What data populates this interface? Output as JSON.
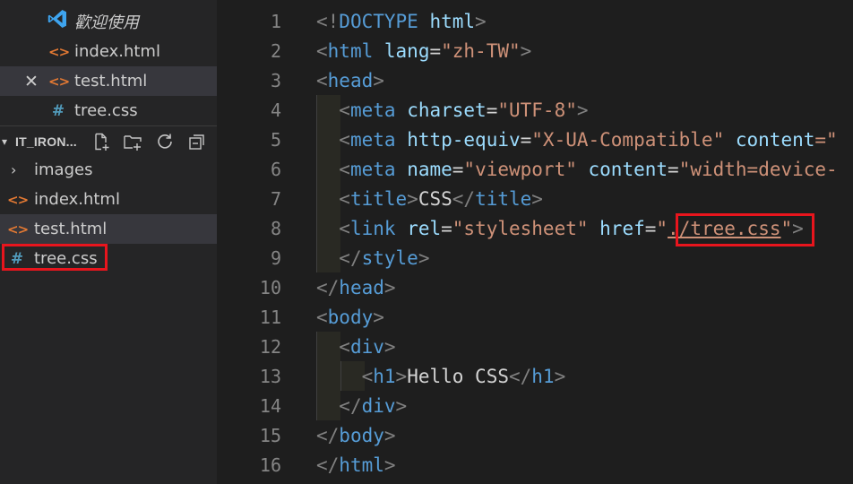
{
  "sidebar": {
    "open_editors": [
      {
        "name": "歡迎使用",
        "icon": "vscode-logo-icon",
        "close_icon": ""
      },
      {
        "name": "index.html",
        "icon": "html-file-icon",
        "close_icon": ""
      },
      {
        "name": "test.html",
        "icon": "html-file-icon",
        "close_icon": "✕",
        "active": true
      },
      {
        "name": "tree.css",
        "icon": "css-file-icon",
        "close_icon": ""
      }
    ],
    "section_title": "IT_IRON...",
    "section_chevron": "▾",
    "file_tree": [
      {
        "name": "images",
        "icon": "folder-chevron-icon",
        "glyph": "›"
      },
      {
        "name": "index.html",
        "icon": "html-file-icon",
        "glyph": "<>"
      },
      {
        "name": "test.html",
        "icon": "html-file-icon",
        "glyph": "<>",
        "active": true
      },
      {
        "name": "tree.css",
        "icon": "css-file-icon",
        "glyph": "#"
      }
    ]
  },
  "editor": {
    "line_numbers": [
      "1",
      "2",
      "3",
      "4",
      "5",
      "6",
      "7",
      "8",
      "9",
      "10",
      "11",
      "12",
      "13",
      "14",
      "15",
      "16"
    ],
    "lines": [
      [
        {
          "t": "<!",
          "c": "punc"
        },
        {
          "t": "DOCTYPE",
          "c": "tag"
        },
        {
          "t": " ",
          "c": "text"
        },
        {
          "t": "html",
          "c": "attr"
        },
        {
          "t": ">",
          "c": "punc"
        }
      ],
      [
        {
          "t": "<",
          "c": "punc"
        },
        {
          "t": "html",
          "c": "tag"
        },
        {
          "t": " ",
          "c": "text"
        },
        {
          "t": "lang",
          "c": "attr"
        },
        {
          "t": "=",
          "c": "text"
        },
        {
          "t": "\"zh-TW\"",
          "c": "str"
        },
        {
          "t": ">",
          "c": "punc"
        }
      ],
      [
        {
          "t": "<",
          "c": "punc"
        },
        {
          "t": "head",
          "c": "tag"
        },
        {
          "t": ">",
          "c": "punc"
        }
      ],
      [
        {
          "t": "  ",
          "c": "text"
        },
        {
          "t": "<",
          "c": "punc"
        },
        {
          "t": "meta",
          "c": "tag"
        },
        {
          "t": " ",
          "c": "text"
        },
        {
          "t": "charset",
          "c": "attr"
        },
        {
          "t": "=",
          "c": "text"
        },
        {
          "t": "\"UTF-8\"",
          "c": "str"
        },
        {
          "t": ">",
          "c": "punc"
        }
      ],
      [
        {
          "t": "  ",
          "c": "text"
        },
        {
          "t": "<",
          "c": "punc"
        },
        {
          "t": "meta",
          "c": "tag"
        },
        {
          "t": " ",
          "c": "text"
        },
        {
          "t": "http-equiv",
          "c": "attr"
        },
        {
          "t": "=",
          "c": "text"
        },
        {
          "t": "\"X-UA-Compatible\"",
          "c": "str"
        },
        {
          "t": " ",
          "c": "text"
        },
        {
          "t": "content",
          "c": "attr"
        },
        {
          "t": "=\"",
          "c": "str"
        }
      ],
      [
        {
          "t": "  ",
          "c": "text"
        },
        {
          "t": "<",
          "c": "punc"
        },
        {
          "t": "meta",
          "c": "tag"
        },
        {
          "t": " ",
          "c": "text"
        },
        {
          "t": "name",
          "c": "attr"
        },
        {
          "t": "=",
          "c": "text"
        },
        {
          "t": "\"viewport\"",
          "c": "str"
        },
        {
          "t": " ",
          "c": "text"
        },
        {
          "t": "content",
          "c": "attr"
        },
        {
          "t": "=",
          "c": "text"
        },
        {
          "t": "\"width=device-",
          "c": "str"
        }
      ],
      [
        {
          "t": "  ",
          "c": "text"
        },
        {
          "t": "<",
          "c": "punc"
        },
        {
          "t": "title",
          "c": "tag"
        },
        {
          "t": ">",
          "c": "punc"
        },
        {
          "t": "CSS",
          "c": "text"
        },
        {
          "t": "</",
          "c": "punc"
        },
        {
          "t": "title",
          "c": "tag"
        },
        {
          "t": ">",
          "c": "punc"
        }
      ],
      [
        {
          "t": "  ",
          "c": "text"
        },
        {
          "t": "<",
          "c": "punc"
        },
        {
          "t": "link",
          "c": "tag"
        },
        {
          "t": " ",
          "c": "text"
        },
        {
          "t": "rel",
          "c": "attr"
        },
        {
          "t": "=",
          "c": "text"
        },
        {
          "t": "\"stylesheet\"",
          "c": "str"
        },
        {
          "t": " ",
          "c": "text"
        },
        {
          "t": "href",
          "c": "attr"
        },
        {
          "t": "=",
          "c": "text"
        },
        {
          "t": "\"",
          "c": "str"
        },
        {
          "t": "./tree.css",
          "c": "str link"
        },
        {
          "t": "\"",
          "c": "str"
        },
        {
          "t": ">",
          "c": "punc"
        }
      ],
      [
        {
          "t": "  ",
          "c": "text"
        },
        {
          "t": "</",
          "c": "punc"
        },
        {
          "t": "style",
          "c": "tag"
        },
        {
          "t": ">",
          "c": "punc"
        }
      ],
      [
        {
          "t": "</",
          "c": "punc"
        },
        {
          "t": "head",
          "c": "tag"
        },
        {
          "t": ">",
          "c": "punc"
        }
      ],
      [
        {
          "t": "<",
          "c": "punc"
        },
        {
          "t": "body",
          "c": "tag"
        },
        {
          "t": ">",
          "c": "punc"
        }
      ],
      [
        {
          "t": "  ",
          "c": "text"
        },
        {
          "t": "<",
          "c": "punc"
        },
        {
          "t": "div",
          "c": "tag"
        },
        {
          "t": ">",
          "c": "punc"
        }
      ],
      [
        {
          "t": "    ",
          "c": "text"
        },
        {
          "t": "<",
          "c": "punc"
        },
        {
          "t": "h1",
          "c": "tag"
        },
        {
          "t": ">",
          "c": "punc"
        },
        {
          "t": "Hello CSS",
          "c": "text"
        },
        {
          "t": "</",
          "c": "punc"
        },
        {
          "t": "h1",
          "c": "tag"
        },
        {
          "t": ">",
          "c": "punc"
        }
      ],
      [
        {
          "t": "  ",
          "c": "text"
        },
        {
          "t": "</",
          "c": "punc"
        },
        {
          "t": "div",
          "c": "tag"
        },
        {
          "t": ">",
          "c": "punc"
        }
      ],
      [
        {
          "t": "</",
          "c": "punc"
        },
        {
          "t": "body",
          "c": "tag"
        },
        {
          "t": ">",
          "c": "punc"
        }
      ],
      [
        {
          "t": "</",
          "c": "punc"
        },
        {
          "t": "html",
          "c": "tag"
        },
        {
          "t": ">",
          "c": "punc"
        }
      ]
    ]
  },
  "colors": {
    "sidebar_bg": "#252526",
    "editor_bg": "#1e1e1e",
    "active_row": "#37373d",
    "highlight_box": "#e8151d",
    "tag": "#569cd6",
    "attr": "#9cdcfe",
    "string": "#ce9178"
  }
}
